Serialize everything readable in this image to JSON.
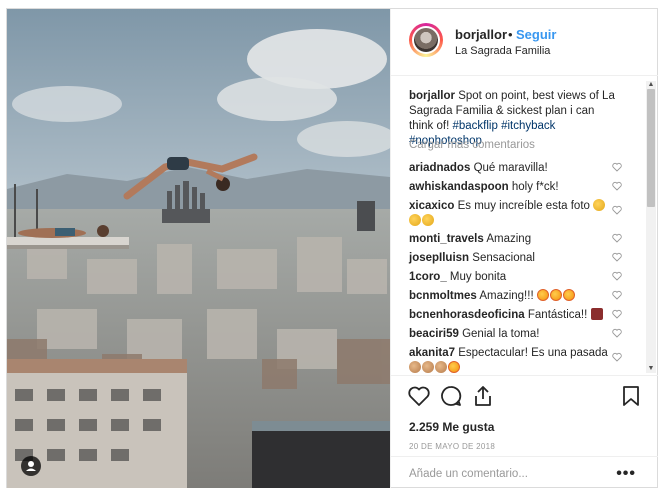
{
  "header": {
    "username": "borjallor",
    "separator": "•",
    "follow_label": "Seguir",
    "location": "La Sagrada Familia"
  },
  "caption": {
    "username": "borjallor",
    "text": "Spot on point, best views of La Sagrada Familia & sickest plan i can think of!",
    "hashtags": "#backflip #itchyback #nophotoshop"
  },
  "load_more_label": "Cargar más comentarios",
  "comments": [
    {
      "user": "ariadnados",
      "text": "Qué maravilla!",
      "emoji": []
    },
    {
      "user": "awhiskandaspoon",
      "text": "holy f*ck!",
      "emoji": []
    },
    {
      "user": "xicaxico",
      "text": "Es muy increíble esta foto",
      "emoji": [
        "clap",
        "clap",
        "clap"
      ]
    },
    {
      "user": "monti_travels",
      "text": "Amazing",
      "emoji": []
    },
    {
      "user": "josepIluisn",
      "text": "Sensacional",
      "emoji": []
    },
    {
      "user": "1coro_",
      "text": "Muy bonita",
      "emoji": []
    },
    {
      "user": "bcnmoltmes",
      "text": "Amazing!!!",
      "emoji": [
        "heart-eyes",
        "heart-eyes",
        "heart-eyes"
      ]
    },
    {
      "user": "bcnenhorasdeoficina",
      "text": "Fantástica!!",
      "emoji": [
        "rock"
      ]
    },
    {
      "user": "beaciri59",
      "text": "Genial la toma!",
      "emoji": []
    },
    {
      "user": "akanita7",
      "text": "Espectacular! Es una pasada",
      "emoji": [
        "hand",
        "hand",
        "hand",
        "heart-eyes"
      ]
    }
  ],
  "likes": "2.259 Me gusta",
  "date": "20 DE MAYO DE 2018",
  "add_comment_placeholder": "Añade un comentario...",
  "more_label": "•••",
  "icons": [
    "heart-icon",
    "comment-icon",
    "share-icon",
    "bookmark-icon",
    "heart-small-icon",
    "user-tag-icon"
  ],
  "colors": {
    "link_blue": "#3897f0",
    "muted": "#999999",
    "text": "#262626",
    "border": "#efefef"
  }
}
